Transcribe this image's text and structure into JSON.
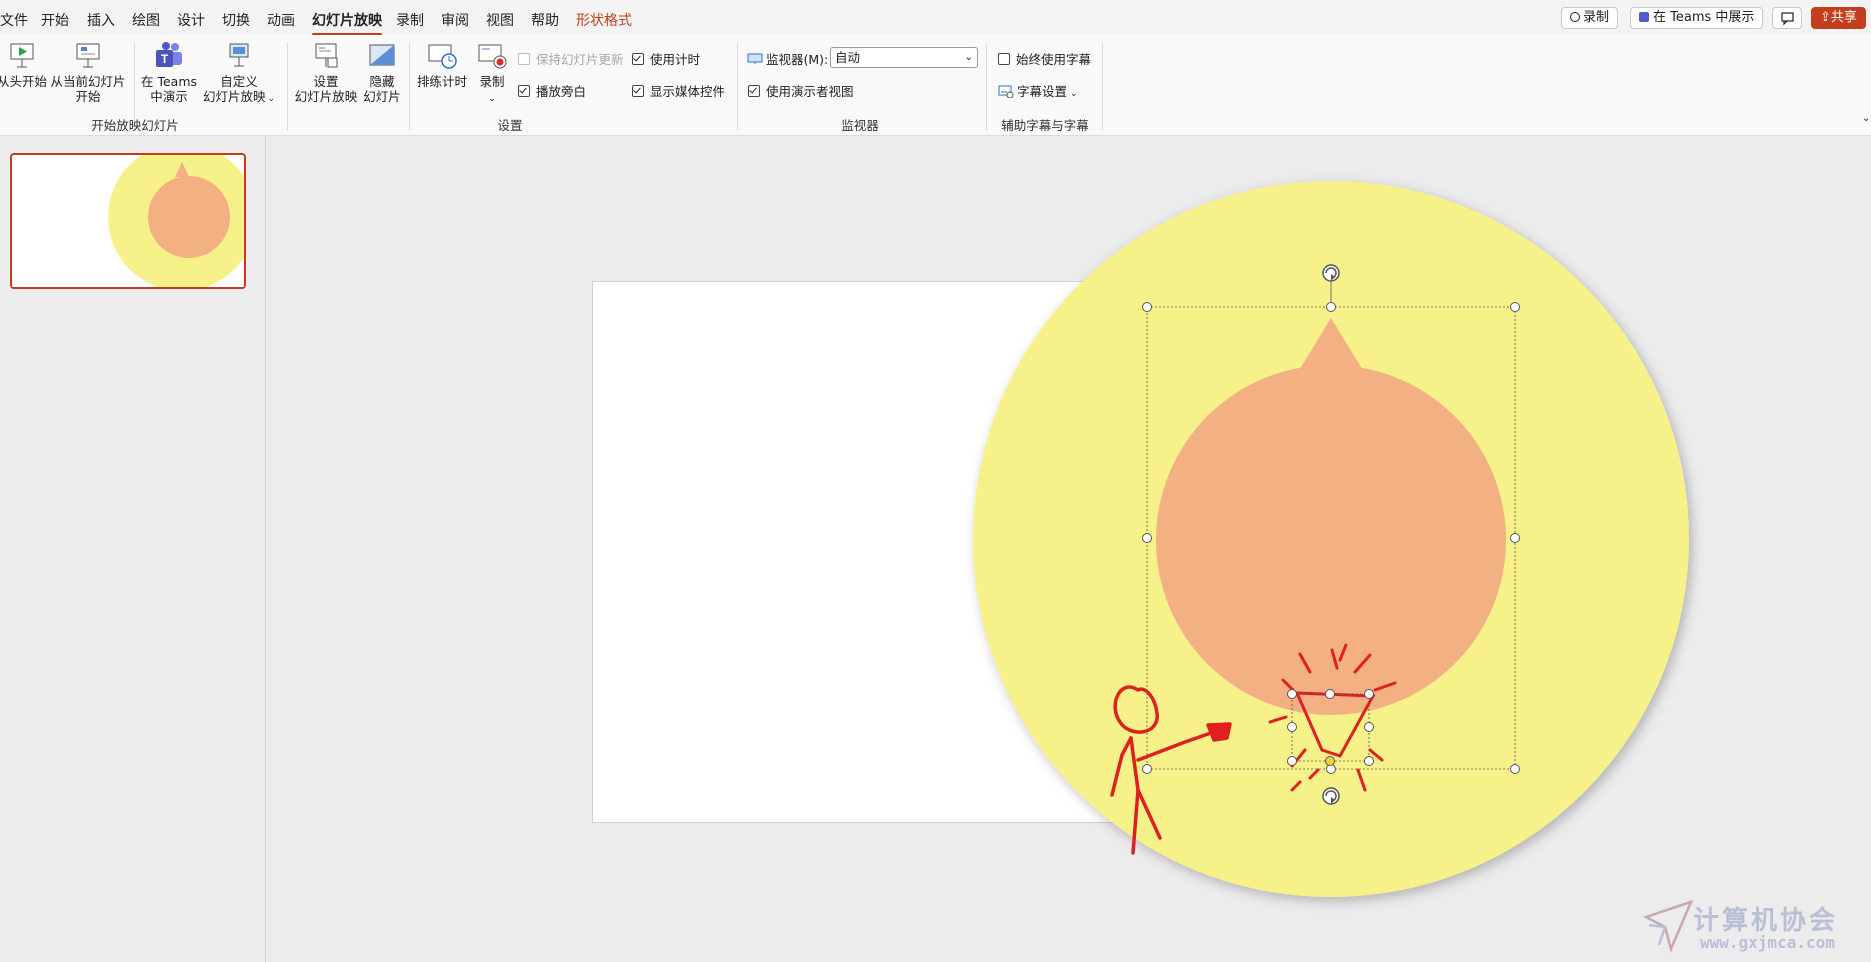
{
  "menu": {
    "file": "文件",
    "home": "开始",
    "insert": "插入",
    "draw": "绘图",
    "design": "设计",
    "transitions": "切换",
    "animations": "动画",
    "slideshow": "幻灯片放映",
    "record": "录制",
    "review": "审阅",
    "view": "视图",
    "help": "帮助",
    "shape_format": "形状格式"
  },
  "top_buttons": {
    "record": "录制",
    "teams": "在 Teams 中展示",
    "share": "共享"
  },
  "ribbon": {
    "from_beginning": "从头开始",
    "from_current_line1": "从当前幻灯片",
    "from_current_line2": "开始",
    "present_teams_line1": "在 Teams",
    "present_teams_line2": "中演示",
    "custom_line1": "自定义",
    "custom_line2": "幻灯片放映",
    "group_start": "开始放映幻灯片",
    "setup_line1": "设置",
    "setup_line2": "幻灯片放映",
    "hide_line1": "隐藏",
    "hide_line2": "幻灯片",
    "rehearse": "排练计时",
    "record": "录制",
    "keep_updated": "保持幻灯片更新",
    "play_narrations": "播放旁白",
    "use_timings": "使用计时",
    "show_media_controls": "显示媒体控件",
    "group_setup": "设置",
    "monitor_label": "监视器(M):",
    "monitor_value": "自动",
    "use_presenter_view": "使用演示者视图",
    "group_monitors": "监视器",
    "always_subtitles": "始终使用字幕",
    "subtitle_settings": "字幕设置",
    "group_captions": "辅助字幕与字幕"
  },
  "colors": {
    "accent": "#c43e1c",
    "yellow": "#f7f18a",
    "salmon": "#f3b082",
    "ink": "#e01f1f"
  },
  "watermark": {
    "title": "计算机协会",
    "url": "www.gxjmca.com"
  }
}
